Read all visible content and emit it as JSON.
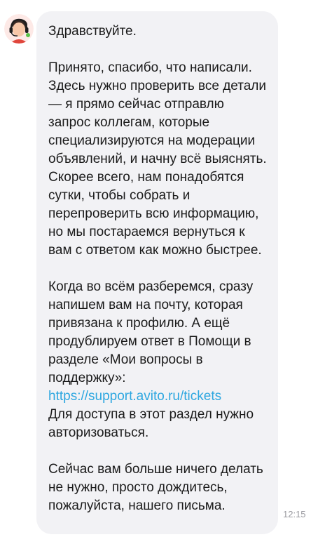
{
  "message": {
    "greeting": "Здравствуйте.",
    "paragraph1": "Принято, спасибо, что написали. Здесь нужно проверить все детали — я прямо сейчас отправлю запрос коллегам, которые специализируются на модерации объявлений, и начну всё выяснять. Скорее всего, нам понадобятся сутки, чтобы собрать и перепроверить всю информацию, но мы постараемся вернуться к вам с ответом как можно быстрее.",
    "paragraph2_before_link": "Когда во всём разберемся, сразу напишем вам на почту, которая привязана к профилю. А ещё продублируем ответ в Помощи в разделе «Мои вопросы в поддержку»:",
    "link_text": "https://support.avito.ru/tickets",
    "paragraph2_after_link": "Для доступа в этот раздел нужно авторизоваться.",
    "paragraph3": "Сейчас вам больше ничего делать не нужно, просто дождитесь, пожалуйста, нашего письма.",
    "time": "12:15"
  },
  "colors": {
    "bubble_background": "#f2f2f5",
    "link": "#2ea7e0",
    "timestamp": "#9a9aa0"
  },
  "icons": {
    "avatar": "support-agent-avatar-icon"
  }
}
